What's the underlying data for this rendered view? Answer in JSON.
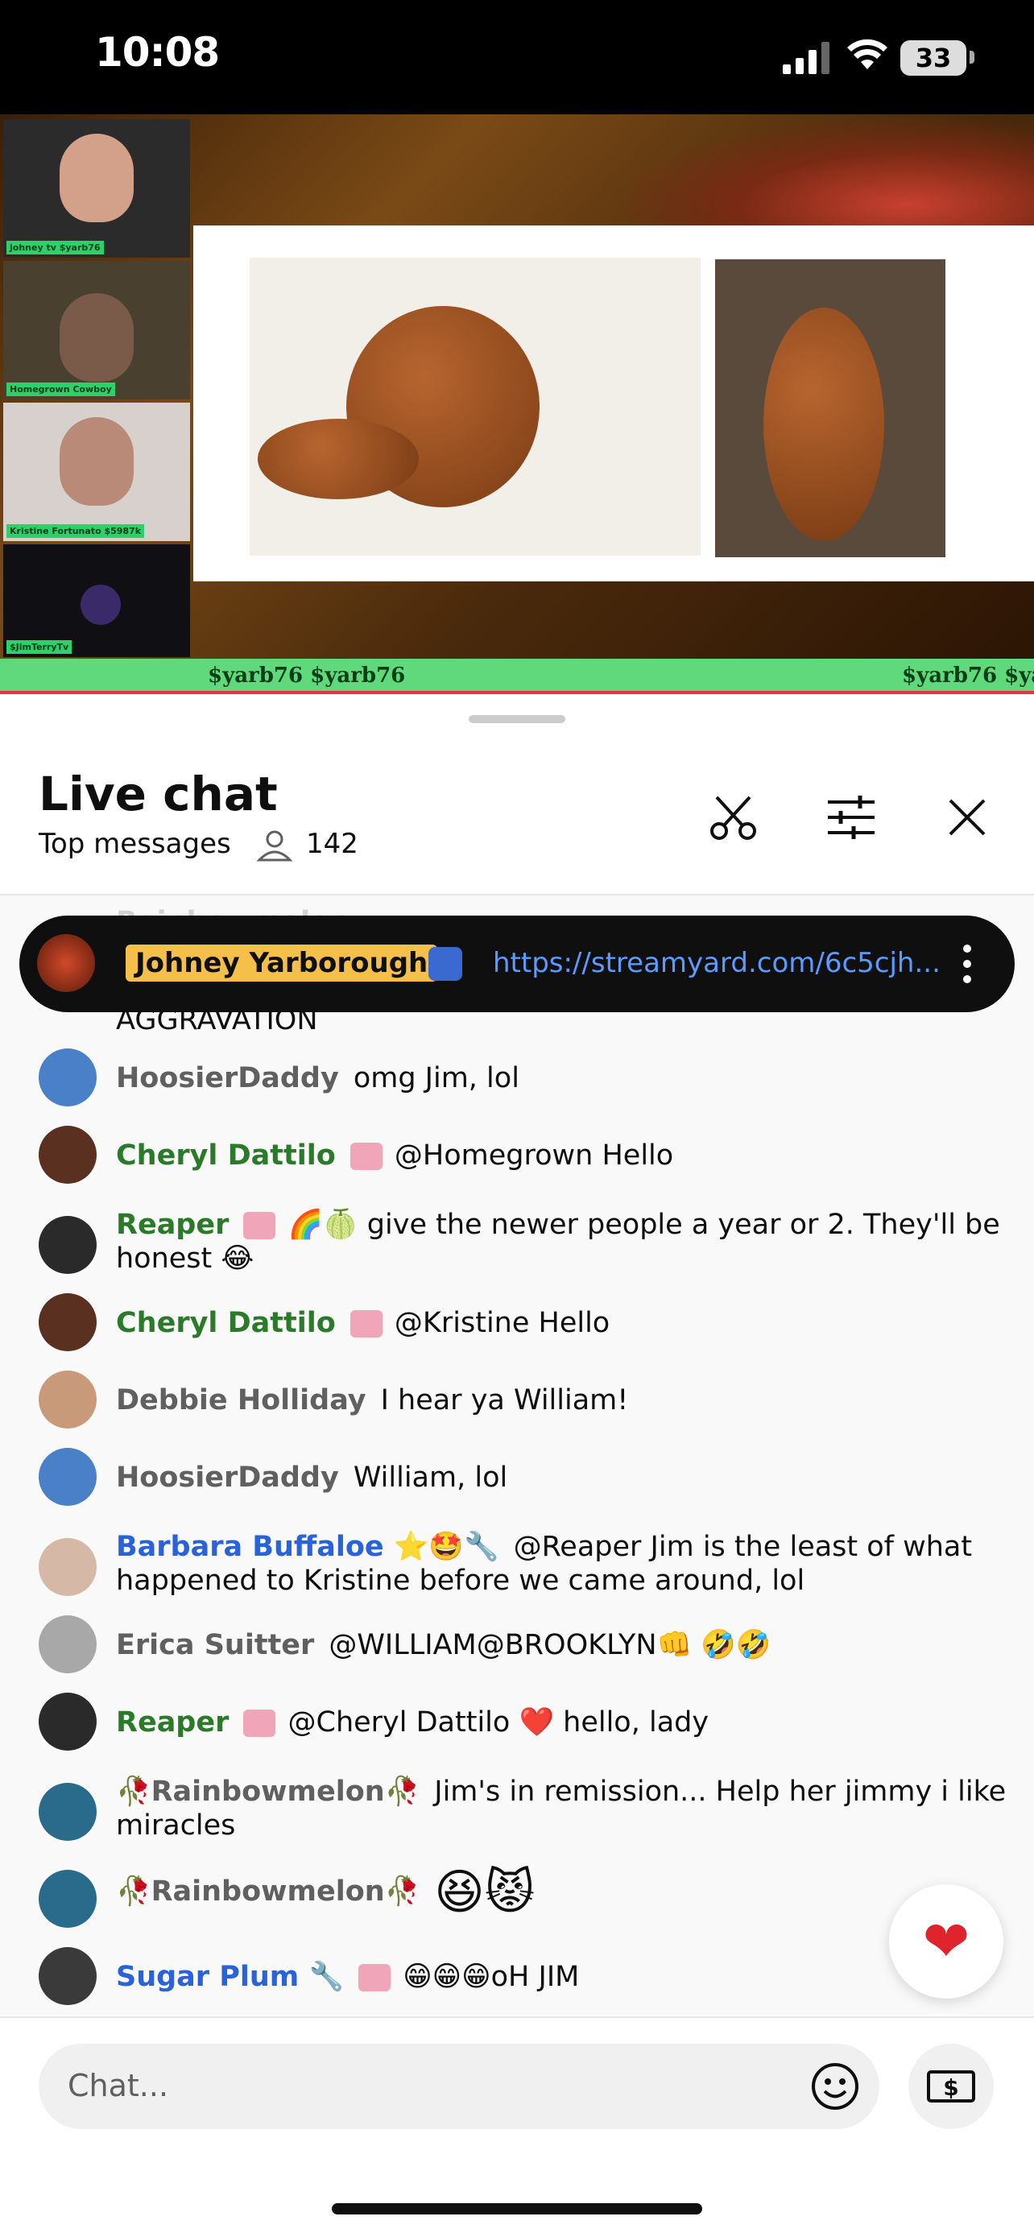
{
  "status_bar": {
    "time": "10:08",
    "battery": "33"
  },
  "stream": {
    "cams": [
      {
        "label": "johney tv $yarb76"
      },
      {
        "label": "Homegrown Cowboy"
      },
      {
        "label": "Kristine Fortunato $5987k"
      },
      {
        "label": "$JimTerryTv"
      }
    ],
    "ticker_left": "$yarb76 $yarb76",
    "ticker_right": "$yarb76 $yar"
  },
  "live_chat": {
    "title": "Live chat",
    "subtitle": "Top messages",
    "viewer_count": "142",
    "icons": [
      "scissors-icon",
      "tune-icon",
      "close-icon"
    ]
  },
  "pinned": {
    "author": "Johney Yarborough",
    "link": "https://streamyard.com/6c5cjh..."
  },
  "partial_top": {
    "author": "Rainbowmelon",
    "text": "AGGRAVATION"
  },
  "messages": [
    {
      "author": "HoosierDaddy",
      "text": "omg Jim, lol"
    },
    {
      "author": "Cheryl Dattilo",
      "text": "@Homegrown Hello"
    },
    {
      "author": "Reaper",
      "text": "🌈🍈 give the newer people a year or 2. They'll be honest 😂"
    },
    {
      "author": "Cheryl Dattilo",
      "text": "@Kristine Hello"
    },
    {
      "author": "Debbie Holliday",
      "text": "I hear ya William!"
    },
    {
      "author": "HoosierDaddy",
      "text": "William, lol"
    },
    {
      "author": "Barbara Buffaloe ⭐🤩🔧",
      "text": "@Reaper Jim is the least of what happened to Kristine before we came around, lol"
    },
    {
      "author": "Erica Suitter",
      "text": "@WILLIAM@BROOKLYN👊 🤣🤣"
    },
    {
      "author": "Reaper",
      "text": "@Cheryl Dattilo ❤️ hello, lady"
    },
    {
      "author": "🥀Rainbowmelon🥀",
      "text": "Jim's in remission... Help her jimmy i like miracles"
    },
    {
      "author": "🥀Rainbowmelon🥀",
      "text": "😆😾"
    },
    {
      "author": "Sugar Plum 🔧",
      "text": "😁😁😁oH JIM"
    }
  ],
  "colors": {
    "gray_author": "#606060",
    "green_author": "#2a7a2a",
    "blue_author": "#2962d9",
    "link": "#5b9bff",
    "heart": "#e0242e"
  },
  "input": {
    "placeholder": "Chat..."
  },
  "fab": {
    "icon": "heart-icon"
  }
}
